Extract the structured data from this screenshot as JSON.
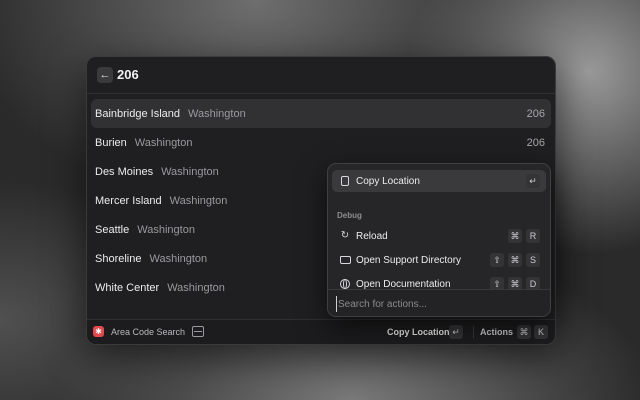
{
  "header": {
    "back_icon": "arrow-left-icon",
    "query": "206"
  },
  "results": [
    {
      "city": "Bainbridge Island",
      "state": "Washington",
      "code": "206",
      "selected": true
    },
    {
      "city": "Burien",
      "state": "Washington",
      "code": "206"
    },
    {
      "city": "Des Moines",
      "state": "Washington",
      "code": ""
    },
    {
      "city": "Mercer Island",
      "state": "Washington",
      "code": ""
    },
    {
      "city": "Seattle",
      "state": "Washington",
      "code": ""
    },
    {
      "city": "Shoreline",
      "state": "Washington",
      "code": ""
    },
    {
      "city": "White Center",
      "state": "Washington",
      "code": ""
    }
  ],
  "footer": {
    "app_name": "Area Code Search",
    "primary_action": "Copy Location",
    "primary_key": "↵",
    "actions_label": "Actions",
    "actions_keys": [
      "⌘",
      "K"
    ]
  },
  "action_panel": {
    "items": [
      {
        "label": "Copy Location",
        "icon": "clipboard-icon",
        "keys": [
          "↵"
        ],
        "selected": true
      }
    ],
    "section_title": "Debug",
    "debug_items": [
      {
        "label": "Reload",
        "icon": "reload-icon",
        "keys": [
          "⌘",
          "R"
        ]
      },
      {
        "label": "Open Support Directory",
        "icon": "folder-icon",
        "keys": [
          "⇧",
          "⌘",
          "S"
        ]
      },
      {
        "label": "Open Documentation",
        "icon": "globe-icon",
        "keys": [
          "⇧",
          "⌘",
          "D"
        ]
      }
    ],
    "search_placeholder": "Search for actions..."
  },
  "colors": {
    "accent_red": "#e5484d",
    "background": "#1f1f21",
    "selected_row": "#313134"
  }
}
